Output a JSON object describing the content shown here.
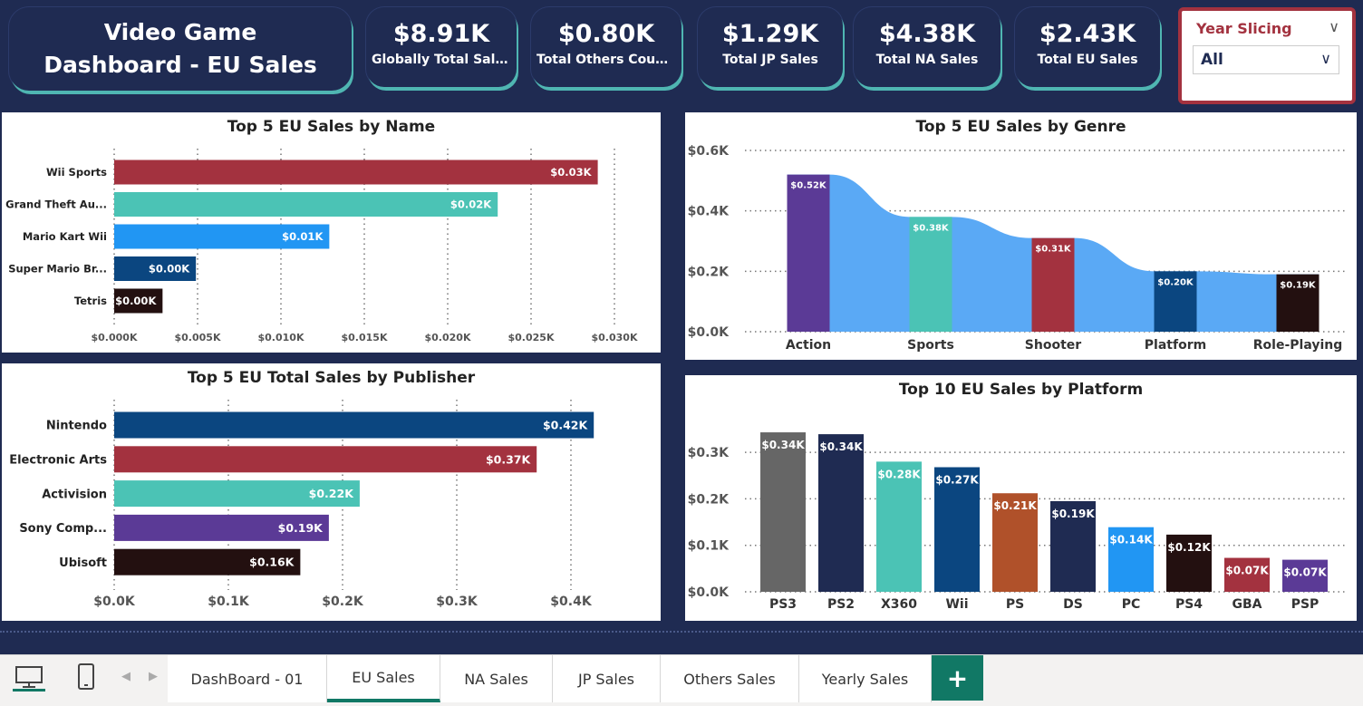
{
  "header": {
    "title_line1": "Video Game",
    "title_line2": "Dashboard - EU Sales"
  },
  "kpis": [
    {
      "value": "$8.91K",
      "label": "Globally Total Sales"
    },
    {
      "value": "$0.80K",
      "label": "Total Others Countr..."
    },
    {
      "value": "$1.29K",
      "label": "Total JP Sales"
    },
    {
      "value": "$4.38K",
      "label": "Total NA Sales"
    },
    {
      "value": "$2.43K",
      "label": "Total EU Sales"
    }
  ],
  "slicer": {
    "title": "Year Slicing",
    "value": "All"
  },
  "colors": {
    "background": "#1f2b52",
    "accent": "#4fb6b2",
    "slicer": "#a3323f",
    "tab_active": "#117865"
  },
  "chart_data": [
    {
      "type": "bar",
      "orientation": "horizontal",
      "title": "Top 5 EU Sales by Name",
      "categories": [
        "Wii Sports",
        "Grand Theft Au...",
        "Mario Kart Wii",
        "Super Mario Br...",
        "Tetris"
      ],
      "values": [
        0.029,
        0.023,
        0.0129,
        0.0049,
        0.0029
      ],
      "data_labels": [
        "$0.03K",
        "$0.02K",
        "$0.01K",
        "$0.00K",
        "$0.00K"
      ],
      "colors": [
        "#a3323f",
        "#4bc3b5",
        "#2196f3",
        "#0b4680",
        "#231010"
      ],
      "xlim": [
        0,
        0.03
      ],
      "tick_values": [
        0,
        0.005,
        0.01,
        0.015,
        0.02,
        0.025,
        0.03
      ],
      "tick_labels": [
        "$0.000K",
        "$0.005K",
        "$0.010K",
        "$0.015K",
        "$0.020K",
        "$0.025K",
        "$0.030K"
      ],
      "grid": "vertical dotted"
    },
    {
      "type": "bar",
      "orientation": "horizontal",
      "title": "Top 5 EU Total Sales by Publisher",
      "categories": [
        "Nintendo",
        "Electronic Arts",
        "Activision",
        "Sony Comp...",
        "Ubisoft"
      ],
      "values": [
        0.42,
        0.37,
        0.215,
        0.188,
        0.163
      ],
      "data_labels": [
        "$0.42K",
        "$0.37K",
        "$0.22K",
        "$0.19K",
        "$0.16K"
      ],
      "colors": [
        "#0b4680",
        "#a3323f",
        "#4bc3b5",
        "#5b3a96",
        "#231010"
      ],
      "xlim": [
        0,
        0.45
      ],
      "tick_values": [
        0,
        0.1,
        0.2,
        0.3,
        0.4
      ],
      "tick_labels": [
        "$0.0K",
        "$0.1K",
        "$0.2K",
        "$0.3K",
        "$0.4K"
      ],
      "grid": "vertical dotted"
    },
    {
      "type": "bar",
      "subtype": "ribbon",
      "title": "Top 5 EU Sales by Genre",
      "categories": [
        "Action",
        "Sports",
        "Shooter",
        "Platform",
        "Role-Playing"
      ],
      "values": [
        0.52,
        0.38,
        0.31,
        0.2,
        0.19
      ],
      "data_labels": [
        "$0.52K",
        "$0.38K",
        "$0.31K",
        "$0.20K",
        "$0.19K"
      ],
      "colors": [
        "#5b3a96",
        "#4bc3b5",
        "#a3323f",
        "#0b4680",
        "#231010"
      ],
      "ribbon_color": "#5aa9f5",
      "ylim": [
        0,
        0.6
      ],
      "tick_values": [
        0,
        0.2,
        0.4,
        0.6
      ],
      "tick_labels": [
        "$0.0K",
        "$0.2K",
        "$0.4K",
        "$0.6K"
      ],
      "grid": "horizontal dotted"
    },
    {
      "type": "bar",
      "orientation": "vertical",
      "title": "Top 10 EU Sales by Platform",
      "categories": [
        "PS3",
        "PS2",
        "X360",
        "Wii",
        "PS",
        "DS",
        "PC",
        "PS4",
        "GBA",
        "PSP"
      ],
      "values": [
        0.343,
        0.339,
        0.28,
        0.268,
        0.212,
        0.195,
        0.139,
        0.123,
        0.073,
        0.069
      ],
      "data_labels": [
        "$0.34K",
        "$0.34K",
        "$0.28K",
        "$0.27K",
        "$0.21K",
        "$0.19K",
        "$0.14K",
        "$0.12K",
        "$0.07K",
        "$0.07K"
      ],
      "colors": [
        "#666666",
        "#1f2b52",
        "#4bc3b5",
        "#0b4680",
        "#b0512a",
        "#1f2b52",
        "#2196f3",
        "#231010",
        "#a3323f",
        "#5b3a96"
      ],
      "ylim": [
        0,
        0.38
      ],
      "tick_values": [
        0,
        0.1,
        0.2,
        0.3
      ],
      "tick_labels": [
        "$0.0K",
        "$0.1K",
        "$0.2K",
        "$0.3K"
      ],
      "grid": "horizontal dotted"
    }
  ],
  "tabs": [
    {
      "label": "DashBoard - 01",
      "active": false
    },
    {
      "label": "EU Sales",
      "active": true
    },
    {
      "label": "NA Sales",
      "active": false
    },
    {
      "label": "JP Sales",
      "active": false
    },
    {
      "label": "Others Sales",
      "active": false
    },
    {
      "label": "Yearly Sales",
      "active": false
    }
  ],
  "add_tab_label": "+",
  "view_icons": [
    "desktop-icon",
    "mobile-icon"
  ]
}
